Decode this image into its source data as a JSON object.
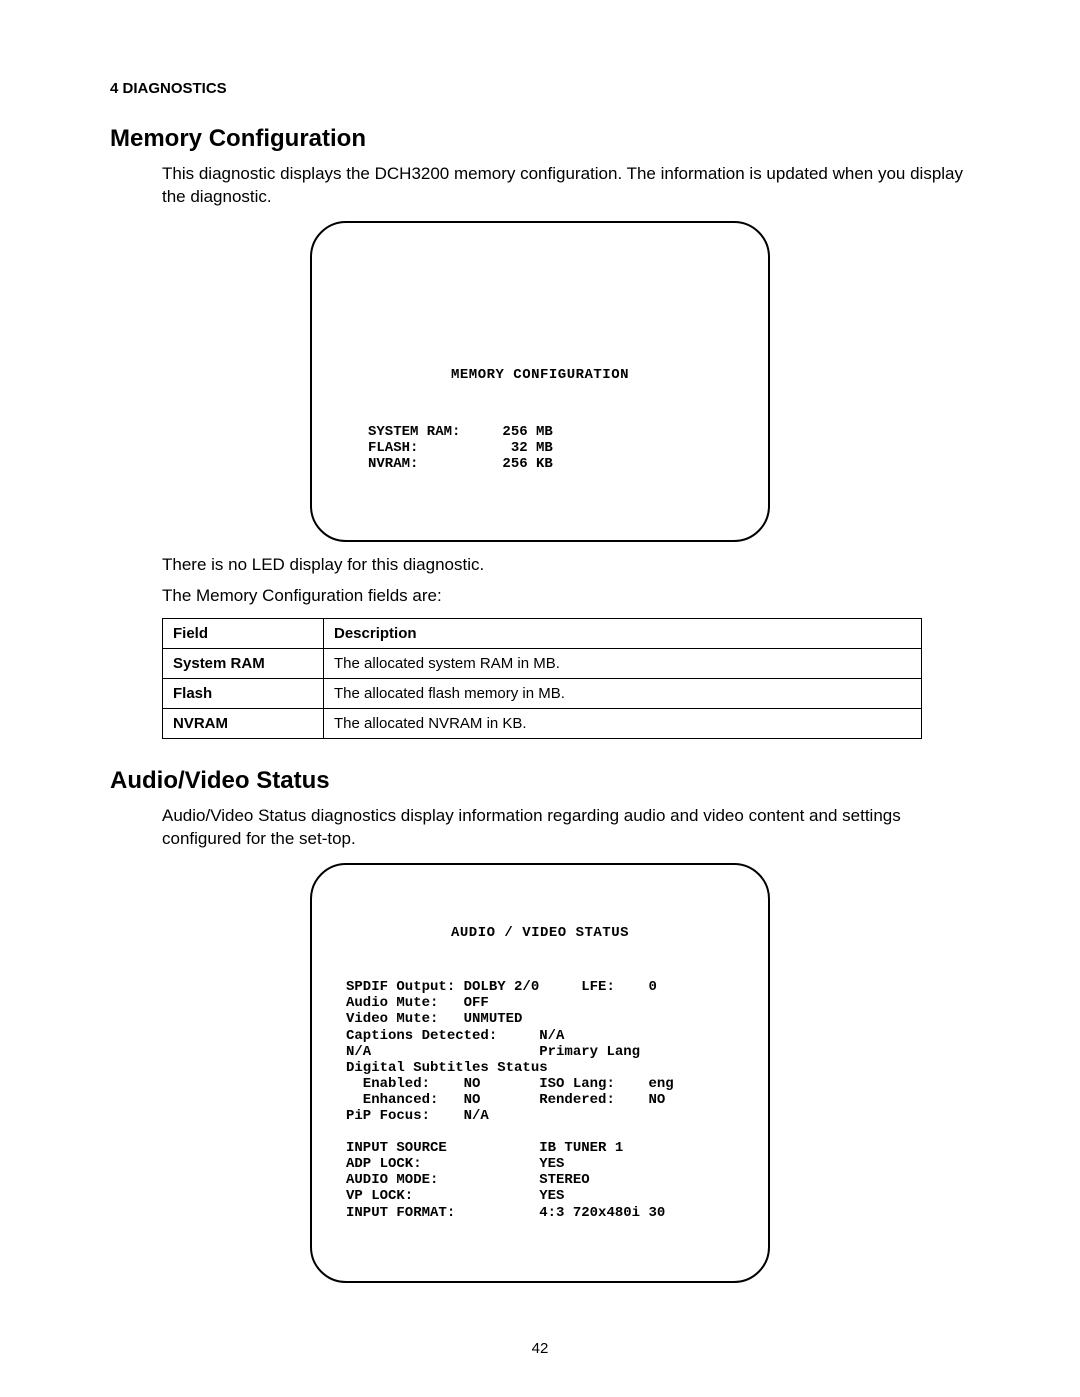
{
  "chapter": "4 DIAGNOSTICS",
  "section1": {
    "title": "Memory Configuration",
    "intro": "This diagnostic displays the DCH3200 memory configuration. The information is updated when you display the diagnostic.",
    "screen": {
      "title": "MEMORY CONFIGURATION",
      "rows": [
        {
          "label": "SYSTEM RAM:",
          "value": "256 MB"
        },
        {
          "label": "FLASH:",
          "value": " 32 MB"
        },
        {
          "label": "NVRAM:",
          "value": "256 KB"
        }
      ]
    },
    "after1": "There is no LED display for this diagnostic.",
    "after2": "The Memory Configuration fields are:",
    "table": {
      "headers": {
        "field": "Field",
        "desc": "Description"
      },
      "rows": [
        {
          "field": "System RAM",
          "desc": "The allocated system RAM in MB."
        },
        {
          "field": "Flash",
          "desc": "The allocated flash memory in MB."
        },
        {
          "field": "NVRAM",
          "desc": "The allocated NVRAM in KB."
        }
      ]
    }
  },
  "section2": {
    "title": "Audio/Video Status",
    "intro": "Audio/Video Status diagnostics display information regarding audio and video content and settings configured for the set-top.",
    "screen": {
      "title": "AUDIO / VIDEO STATUS",
      "lines": [
        "SPDIF Output: DOLBY 2/0     LFE:    0",
        "Audio Mute:   OFF",
        "Video Mute:   UNMUTED",
        "Captions Detected:     N/A",
        "N/A                    Primary Lang",
        "Digital Subtitles Status",
        "  Enabled:    NO       ISO Lang:    eng",
        "  Enhanced:   NO       Rendered:    NO",
        "PiP Focus:    N/A",
        "",
        "INPUT SOURCE           IB TUNER 1",
        "ADP LOCK:              YES",
        "AUDIO MODE:            STEREO",
        "VP LOCK:               YES",
        "INPUT FORMAT:          4:3 720x480i 30"
      ]
    }
  },
  "page_number": "42"
}
